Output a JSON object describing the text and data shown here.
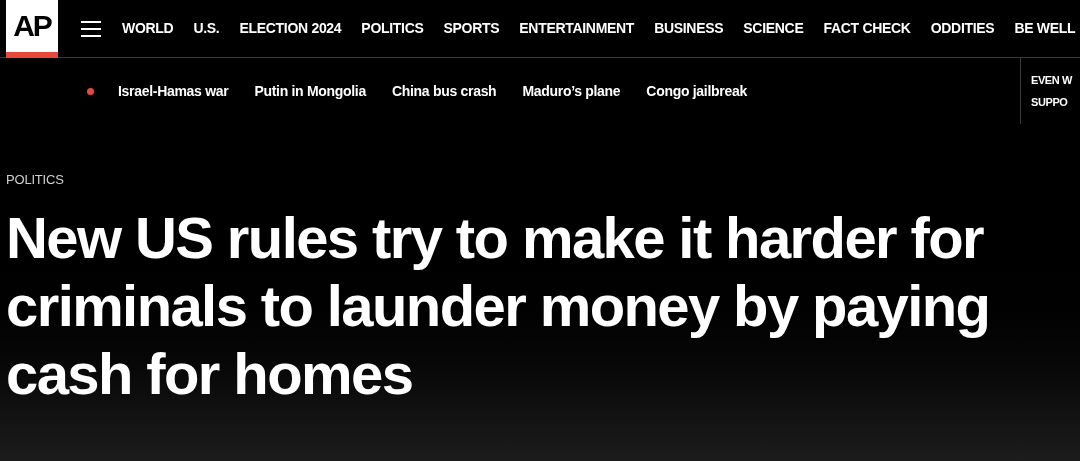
{
  "logo": {
    "text": "AP"
  },
  "nav": [
    "WORLD",
    "U.S.",
    "ELECTION 2024",
    "POLITICS",
    "SPORTS",
    "ENTERTAINMENT",
    "BUSINESS",
    "SCIENCE",
    "FACT CHECK",
    "ODDITIES",
    "BE WELL"
  ],
  "trending": {
    "live": true,
    "items": [
      "Israel-Hamas war",
      "Putin in Mongolia",
      "China bus crash",
      "Maduro’s plane",
      "Congo jailbreak"
    ]
  },
  "promo": {
    "lines": [
      "EVEN W",
      "SUPPO"
    ]
  },
  "article": {
    "category": "POLITICS",
    "headline": "New US rules try to make it harder for criminals to launder money by paying cash for homes"
  }
}
